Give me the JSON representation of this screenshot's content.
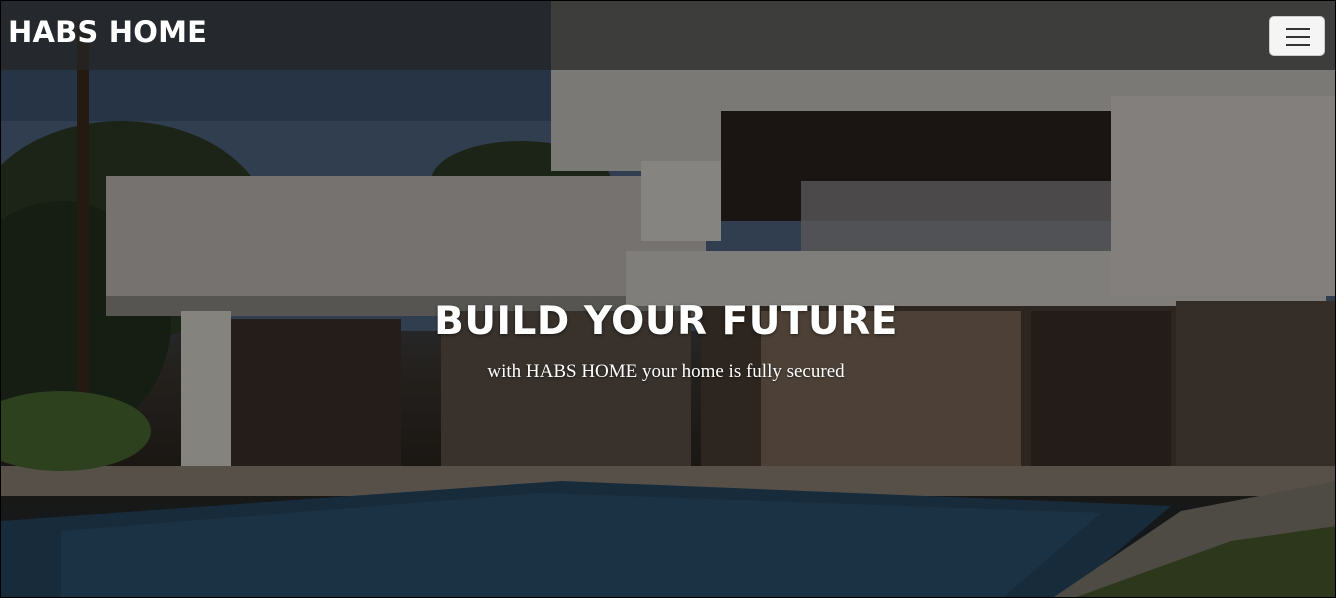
{
  "navbar": {
    "brand": "HABS HOME",
    "toggle_icon": "hamburger-menu-icon"
  },
  "hero": {
    "heading": "BUILD YOUR FUTURE",
    "subheading": "with HABS HOME your home is fully secured",
    "background_image": "modern-villa-with-pool"
  },
  "colors": {
    "text": "#ffffff",
    "navbar_bg": "#262626",
    "toggler_bg": "#f5f5f5"
  }
}
